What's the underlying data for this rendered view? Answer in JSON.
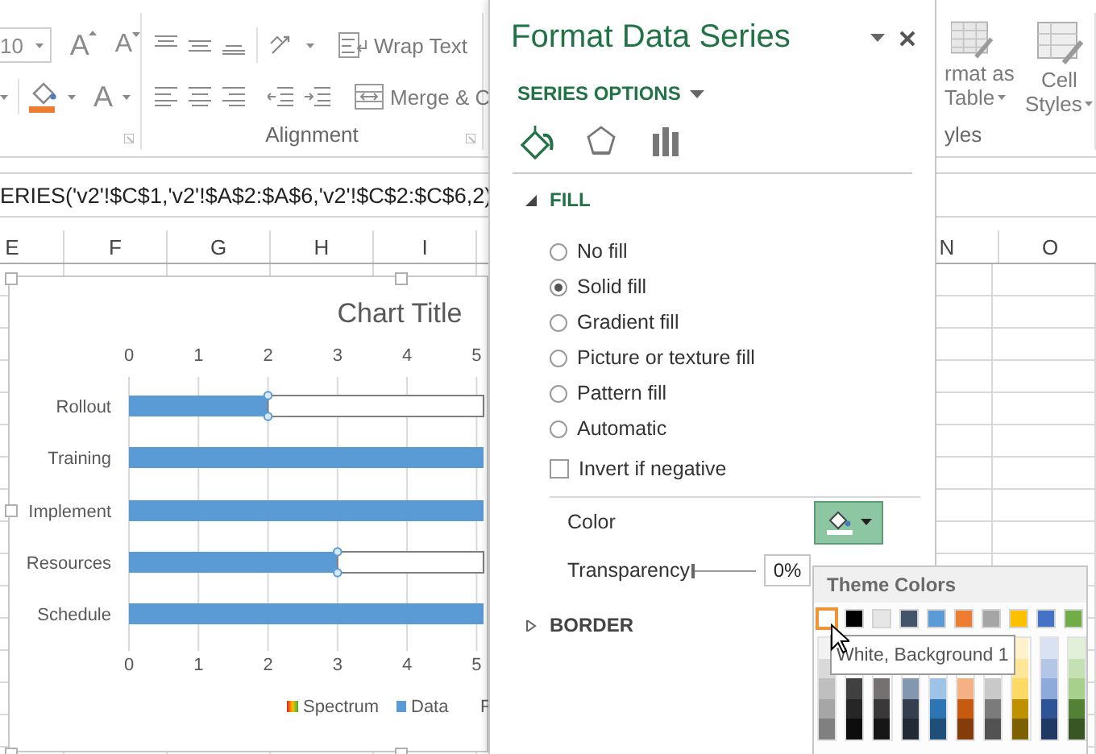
{
  "ribbon": {
    "font_size": "10",
    "grow_font": "A",
    "shrink_font": "A",
    "font_color": "A",
    "wrap_text": "Wrap Text",
    "merge": "Merge & C",
    "alignment_group": "Alignment",
    "format_as_table": [
      "rmat as",
      "Table"
    ],
    "cell_styles": [
      "Cell",
      "Styles"
    ],
    "styles_group": "yles"
  },
  "formula_bar": {
    "formula": "ERIES('v2'!$C$1,'v2'!$A$2:$A$6,'v2'!$C$2:$C$6,2)"
  },
  "column_headers": {
    "left": [
      "E",
      "F",
      "G",
      "H",
      "I"
    ],
    "right": [
      "N",
      "O"
    ]
  },
  "chart": {
    "chart_data": {
      "type": "bar",
      "orientation": "horizontal",
      "stacked": true,
      "title": "Chart Title",
      "grid": true,
      "categories": [
        "Rollout",
        "Training",
        "Implement",
        "Resources",
        "Schedule"
      ],
      "series": [
        {
          "name": "Spectrum",
          "color": "#ffffff",
          "values": [
            3.1,
            null,
            null,
            2.1,
            null
          ]
        },
        {
          "name": "Data",
          "color": "#5b9bd5",
          "values": [
            2,
            5.1,
            5.1,
            3,
            5.1
          ]
        },
        {
          "name": "F",
          "values": [
            null,
            null,
            null,
            null,
            null
          ]
        }
      ],
      "legend": true,
      "xlim": [
        0,
        5.1
      ],
      "xticks": [
        0,
        1,
        2,
        3,
        4,
        5
      ]
    },
    "legend_swatches": [
      {
        "kind": "gradient"
      },
      {
        "kind": "solid"
      },
      {
        "kind": "none"
      }
    ],
    "top_axis_labels": [
      "0",
      "1",
      "2",
      "3",
      "4",
      "5"
    ],
    "bottom_axis_labels": [
      "0",
      "1",
      "2",
      "3",
      "4",
      "5"
    ]
  },
  "pane": {
    "title": "Format Data Series",
    "section": "SERIES OPTIONS",
    "tabs": [
      {
        "kind": "fill",
        "selected": true
      },
      {
        "kind": "effects",
        "selected": false
      },
      {
        "kind": "options",
        "selected": false
      }
    ],
    "fill": {
      "label": "FILL",
      "expanded": true,
      "options": [
        {
          "label": "No fill",
          "selected": false
        },
        {
          "label": "Solid fill",
          "selected": true
        },
        {
          "label": "Gradient fill",
          "selected": false
        },
        {
          "label": "Picture or texture fill",
          "selected": false
        },
        {
          "label": "Pattern fill",
          "selected": false
        },
        {
          "label": "Automatic",
          "selected": false
        }
      ],
      "invert": {
        "label": "Invert if negative",
        "checked": false
      },
      "color_label": "Color",
      "transparency_label": "Transparency",
      "transparency": {
        "level": 0
      },
      "transparency_value": "0%"
    },
    "border": {
      "label": "BORDER",
      "expanded": false
    }
  },
  "color_popup": {
    "title": "Theme Colors",
    "columns": [
      {
        "color": "#ffffff",
        "selected": true,
        "shades": [
          {
            "color": "#f2f2f2",
            "selected": false
          },
          {
            "color": "#d9d9d9",
            "selected": false
          },
          {
            "color": "#bfbfbf",
            "selected": false
          },
          {
            "color": "#a6a6a6",
            "selected": false
          },
          {
            "color": "#808080",
            "selected": false
          }
        ]
      },
      {
        "color": "#000000",
        "selected": false,
        "shades": [
          {
            "color": "#404040",
            "selected": false
          },
          {
            "color": "#262626",
            "selected": false
          },
          {
            "color": "#0d0d0d",
            "selected": false
          }
        ]
      },
      {
        "color": "#e7e6e6",
        "selected": false,
        "shades": [
          {
            "color": "#757171",
            "selected": false
          },
          {
            "color": "#3a3838",
            "selected": false
          },
          {
            "color": "#171616",
            "selected": false
          }
        ]
      },
      {
        "color": "#44546a",
        "selected": false,
        "shades": [
          {
            "color": "#8497b0",
            "selected": false
          },
          {
            "color": "#333f4f",
            "selected": false
          },
          {
            "color": "#222a35",
            "selected": false
          }
        ]
      },
      {
        "color": "#5b9bd5",
        "selected": false,
        "shades": [
          {
            "color": "#9dc3e6",
            "selected": false
          },
          {
            "color": "#2e75b5",
            "selected": false
          },
          {
            "color": "#1f4e79",
            "selected": false
          }
        ]
      },
      {
        "color": "#ed7d31",
        "selected": false,
        "shades": [
          {
            "color": "#f4b183",
            "selected": false
          },
          {
            "color": "#c55a11",
            "selected": false
          },
          {
            "color": "#843c0b",
            "selected": false
          }
        ]
      },
      {
        "color": "#a5a5a5",
        "selected": false,
        "shades": [
          {
            "color": "#c9c9c9",
            "selected": false
          },
          {
            "color": "#7b7b7b",
            "selected": false
          },
          {
            "color": "#525252",
            "selected": false
          }
        ]
      },
      {
        "color": "#ffc000",
        "selected": false,
        "shades": [
          {
            "color": "#fff2cc",
            "selected": false
          },
          {
            "color": "#ffe699",
            "selected": false
          },
          {
            "color": "#ffd966",
            "selected": false
          },
          {
            "color": "#bf9000",
            "selected": false
          },
          {
            "color": "#7f6000",
            "selected": false
          }
        ]
      },
      {
        "color": "#4472c4",
        "selected": false,
        "shades": [
          {
            "color": "#d9e2f3",
            "selected": false
          },
          {
            "color": "#b4c6e7",
            "selected": false
          },
          {
            "color": "#8eaadb",
            "selected": false
          },
          {
            "color": "#2f5496",
            "selected": false
          },
          {
            "color": "#1f3864",
            "selected": false
          }
        ]
      },
      {
        "color": "#70ad47",
        "selected": false,
        "shades": [
          {
            "color": "#e2efd9",
            "selected": false
          },
          {
            "color": "#c5e0b3",
            "selected": false
          },
          {
            "color": "#a8d08d",
            "selected": false
          },
          {
            "color": "#538135",
            "selected": false
          },
          {
            "color": "#375623",
            "selected": false
          }
        ]
      }
    ],
    "tooltip": "White, Background 1"
  }
}
